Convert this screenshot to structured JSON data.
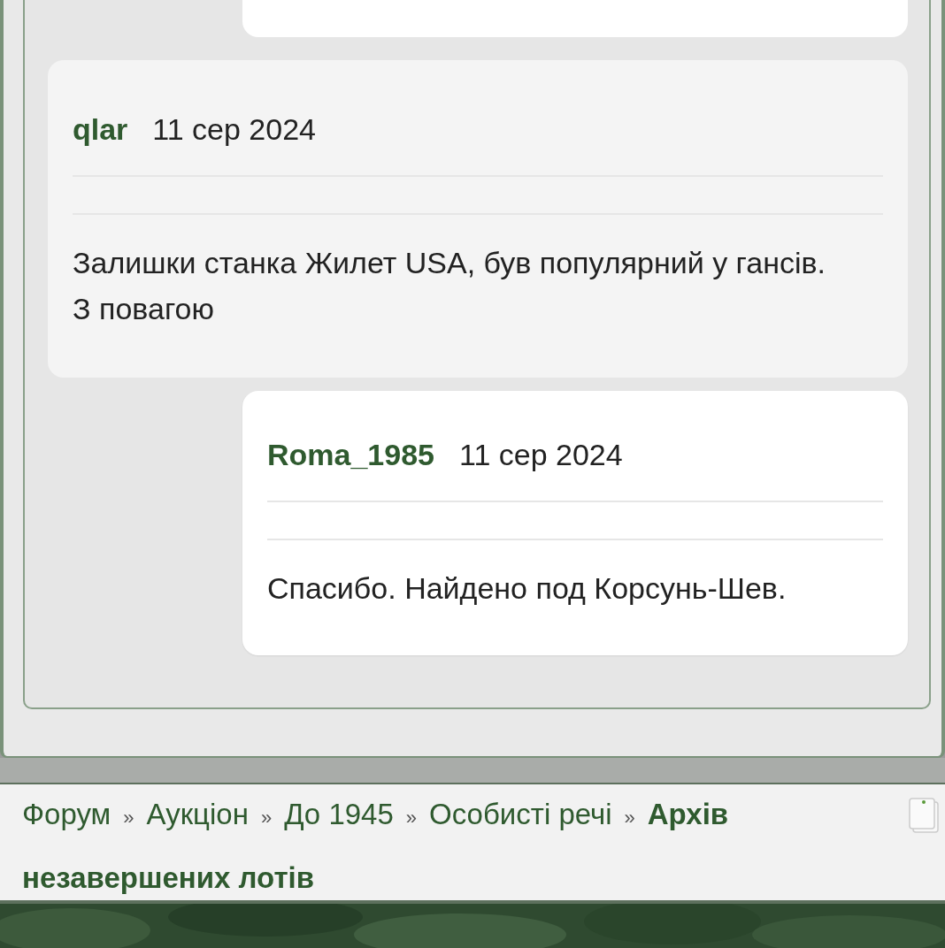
{
  "posts": [
    {
      "kind": "comment",
      "author": "qlar",
      "date": "11 сер 2024",
      "body_lines": [
        "Залишки станка Жилет USA, був популярний у гансів.",
        "З повагою"
      ]
    },
    {
      "kind": "reply",
      "author": "Roma_1985",
      "date": "11 сер 2024",
      "body_lines": [
        "Спасибо. Найдено под Корсунь-Шев."
      ]
    }
  ],
  "breadcrumb": [
    {
      "label": "Форум",
      "current": false,
      "separator": "»"
    },
    {
      "label": "Аукціон",
      "current": false,
      "separator": "»"
    },
    {
      "label": "До 1945",
      "current": false,
      "separator": "»"
    },
    {
      "label": "Особисті речі",
      "current": false,
      "separator": "»"
    },
    {
      "label": "Архів незавершених лотів",
      "current": true
    }
  ]
}
